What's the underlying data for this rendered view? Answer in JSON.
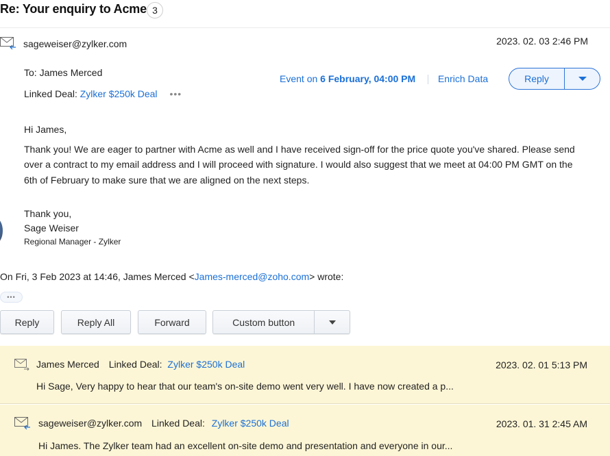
{
  "header": {
    "title": "Re: Your enquiry to Acme",
    "thread_count": "3"
  },
  "message": {
    "from": "sageweiser@zylker.com",
    "date": "2023. 02. 03 2:46 PM",
    "to": "To: James Merced",
    "linked_deal_label": "Linked Deal:",
    "linked_deal": "Zylker $250k Deal",
    "more_dots": "•••",
    "event_prefix": "Event on",
    "event_date": "6 February, 04:00 PM",
    "enrich_data": "Enrich Data",
    "reply_label": "Reply",
    "greeting": "Hi James,",
    "body_lines": [
      "Thank you! We are eager to partner with Acme as well and I have received sign-off for the price quote you've shared. Please send",
      "over a contract to my email address and I will proceed with signature. I would also suggest that we meet at 04:00 PM GMT on the",
      "6th of February to make sure that we are aligned on the next steps."
    ],
    "closing": "Thank you,",
    "signature_name": "Sage Weiser",
    "signature_title": "Regional Manager - Zylker",
    "quote_prefix": "On Fri, 3 Feb 2023 at 14:46, James Merced <",
    "quote_email": "James-merced@zoho.com",
    "quote_suffix": "> wrote:",
    "show_quoted": "•••"
  },
  "actions": {
    "reply": "Reply",
    "reply_all": "Reply All",
    "forward": "Forward",
    "custom": "Custom button"
  },
  "thread": [
    {
      "sender": "James Merced",
      "linked_deal_label": "Linked Deal:",
      "linked_deal": "Zylker $250k Deal",
      "date": "2023. 02. 01 5:13 PM",
      "preview": "Hi Sage, Very happy to hear that our team's on-site demo went very well. I have now created a p..."
    },
    {
      "sender": "sageweiser@zylker.com",
      "linked_deal_label": "Linked Deal:",
      "linked_deal": "Zylker $250k Deal",
      "date": "2023. 01. 31 2:45 AM",
      "preview": "Hi James. The Zylker team had an excellent on-site demo and presentation and everyone in our..."
    }
  ],
  "colors": {
    "link": "#1a6fd6",
    "thread_bg": "#fdf6d6",
    "reply_button_bg": "#eef4fd"
  }
}
